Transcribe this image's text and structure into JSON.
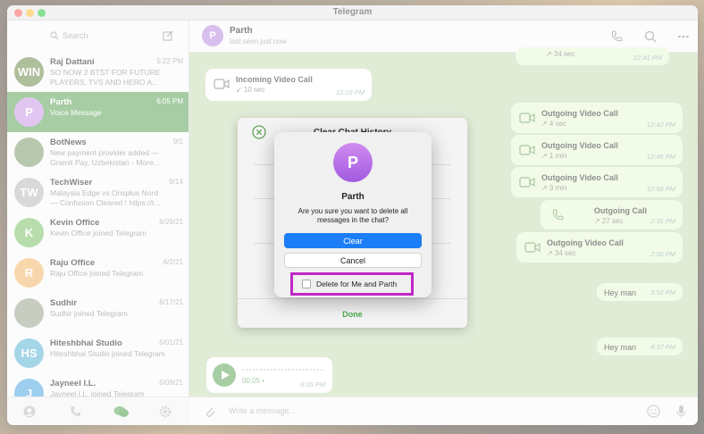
{
  "window": {
    "title": "Telegram"
  },
  "sidebar": {
    "search_label": "Search",
    "chats": [
      {
        "name": "Raj Dattani",
        "date": "5:22 PM",
        "preview": "SO NOW 2 BTST FOR FUTURE PLAYERS, TVS AND HERO A...",
        "avatar": "WIN",
        "color": "#6a8a4a"
      },
      {
        "name": "Parth",
        "date": "6:05 PM",
        "preview": "Voice Message",
        "avatar": "P",
        "color": "#c997e8",
        "active": true
      },
      {
        "name": "BotNews",
        "date": "9/1",
        "preview": "New payment provider added — Gramit Pay, Uzbekistan - More...",
        "avatar": "",
        "color": "#7d9c6e"
      },
      {
        "name": "TechWiser",
        "date": "9/14",
        "preview": "Malaysia Edge vs Onsplus Nord — Confusion Cleared ! https://t...",
        "avatar": "TW",
        "color": "#bbbbbb"
      },
      {
        "name": "Kevin Office",
        "date": "6/29/21",
        "preview": "Kevin Office joined Telegram",
        "avatar": "K",
        "color": "#7ec26b"
      },
      {
        "name": "Raju Office",
        "date": "6/2/21",
        "preview": "Raju Office joined Telegram",
        "avatar": "R",
        "color": "#f2b76a"
      },
      {
        "name": "Sudhir",
        "date": "6/17/21",
        "preview": "Sudhir joined Telegram",
        "avatar": "",
        "color": "#9aa58e"
      },
      {
        "name": "Hiteshbhai Studio",
        "date": "6/01/21",
        "preview": "Hiteshbhai Studio joined Telegram",
        "avatar": "HS",
        "color": "#5bb4d4"
      },
      {
        "name": "Jayneel I.L.",
        "date": "6/09/21",
        "preview": "Jayneel I.L. joined Telegram",
        "avatar": "J",
        "color": "#4ea7e0"
      }
    ]
  },
  "chat": {
    "name": "Parth",
    "status": "last seen just now",
    "avatar": "P",
    "composer_placeholder": "Write a message...",
    "messages": [
      {
        "title": "Incoming Video Call",
        "sub": "↙ 10 sec",
        "time": "12:23 PM"
      },
      {
        "title": "Outgoing Video Call",
        "sub": "↗ 4 sec",
        "time": "12:42 PM"
      },
      {
        "title": "Outgoing Video Call",
        "sub": "↗ 1 min",
        "time": "12:45 PM"
      },
      {
        "title": "Outgoing Video Call",
        "sub": "↗ 3 min",
        "time": "12:58 PM"
      },
      {
        "title": "Outgoing Call",
        "sub": "↗ 27 sec",
        "time": "2:31 PM"
      },
      {
        "title": "Outgoing Video Call",
        "sub": "↗ 34 sec",
        "time": "2:50 PM"
      },
      {
        "text": "Hey man",
        "time": "3:52 PM"
      },
      {
        "text": "Hey man",
        "time": "4:37 PM"
      }
    ],
    "voice_duration": "00:05 •",
    "voice_time": "6:05 PM"
  },
  "back_dialog": {
    "title": "Clear Chat History",
    "done_label": "Done"
  },
  "alert": {
    "avatar": "P",
    "name": "Parth",
    "message": "Are you sure you want to delete all messages in the chat?",
    "clear_label": "Clear",
    "cancel_label": "Cancel",
    "checkbox_label": "Delete for Me and Parth",
    "checkbox_checked": false
  },
  "colors": {
    "accent_green": "#5fa55a",
    "primary_button": "#1b7ef7",
    "highlight": "#c228c9"
  }
}
